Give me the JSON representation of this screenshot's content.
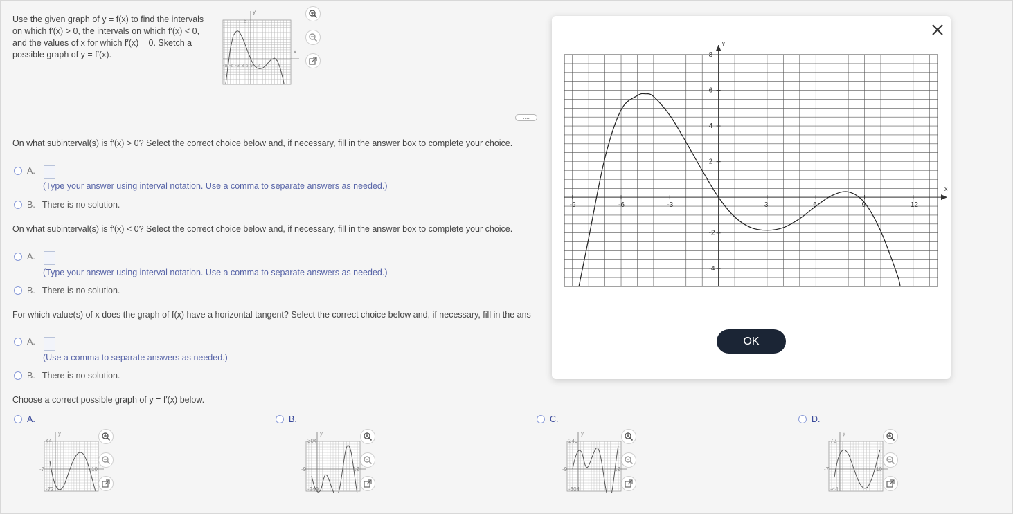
{
  "problem": {
    "prompt": "Use the given graph of y = f(x) to find the intervals on which f′(x) > 0, the intervals on which f′(x) < 0, and the values of x for which f′(x) = 0.  Sketch a possible graph of y = f′(x).",
    "thumb_labels": {
      "y": "y",
      "x": "x",
      "ytick": "8",
      "xticks": "-9 -6 -3  3  6  9 12"
    }
  },
  "icons": {
    "zoom_in": "zoom-in-icon",
    "zoom_out": "zoom-out-icon",
    "popout": "popout-icon",
    "close": "close-icon"
  },
  "divider_handle": "....",
  "questions": [
    {
      "text": "On what subinterval(s) is f′(x) > 0? Select the correct choice below and, if necessary, fill in the answer box to complete your choice.",
      "a_label": "A.",
      "a_hint": "(Type your answer using interval notation. Use a comma to separate answers as needed.)",
      "b_label": "B.",
      "b_text": "There is no solution."
    },
    {
      "text": "On what subinterval(s) is f′(x) < 0? Select the correct choice below and, if necessary, fill in the answer box to complete your choice.",
      "a_label": "A.",
      "a_hint": "(Type your answer using interval notation. Use a comma to separate answers as needed.)",
      "b_label": "B.",
      "b_text": "There is no solution."
    },
    {
      "text": "For which value(s) of x does the graph of f(x) have a horizontal tangent? Select the correct choice below and, if necessary, fill in the ans",
      "a_label": "A.",
      "a_hint": "(Use a comma to separate answers as needed.)",
      "b_label": "B.",
      "b_text": "There is no solution."
    }
  ],
  "graph_question": "Choose a correct possible graph of y = f′(x) below.",
  "graph_options": [
    {
      "label": "A.",
      "ytop": "44",
      "ybot": "-72",
      "xleft": "-7",
      "xright": "10",
      "x": "x",
      "y": "y"
    },
    {
      "label": "B.",
      "ytop": "304",
      "ybot": "-249",
      "xleft": "-9",
      "xright": "12",
      "x": "x",
      "y": "y"
    },
    {
      "label": "C.",
      "ytop": "249",
      "ybot": "-304",
      "xleft": "-9",
      "xright": "12",
      "x": "x",
      "y": "y"
    },
    {
      "label": "D.",
      "ytop": "72",
      "ybot": "-44",
      "xleft": "-7",
      "xright": "10",
      "x": "x",
      "y": "y"
    }
  ],
  "modal": {
    "ok_label": "OK",
    "y_axis_label": "y",
    "x_axis_label": "x",
    "x_ticks": [
      "-9",
      "-6",
      "-3",
      "3",
      "6",
      "9",
      "12"
    ],
    "y_ticks": [
      "8",
      "6",
      "4",
      "2",
      "-2",
      "-4"
    ]
  },
  "chart_data": {
    "type": "line",
    "xlabel": "x",
    "ylabel": "y",
    "xlim": [
      -10,
      13
    ],
    "ylim": [
      -5,
      8
    ],
    "grid": true,
    "x": [
      -8.6,
      -8,
      -7,
      -6,
      -5,
      -4.5,
      -4,
      -3,
      -2,
      -1,
      0,
      1,
      2,
      3,
      4,
      5,
      6,
      7,
      8,
      9,
      10,
      11,
      11.2
    ],
    "y": [
      -5,
      -2.3,
      2.2,
      4.9,
      5.7,
      5.8,
      5.65,
      4.6,
      3.1,
      1.5,
      0,
      -1.1,
      -1.7,
      -1.85,
      -1.7,
      -1.2,
      -0.5,
      0.1,
      0.3,
      -0.3,
      -1.9,
      -4.3,
      -5
    ]
  }
}
